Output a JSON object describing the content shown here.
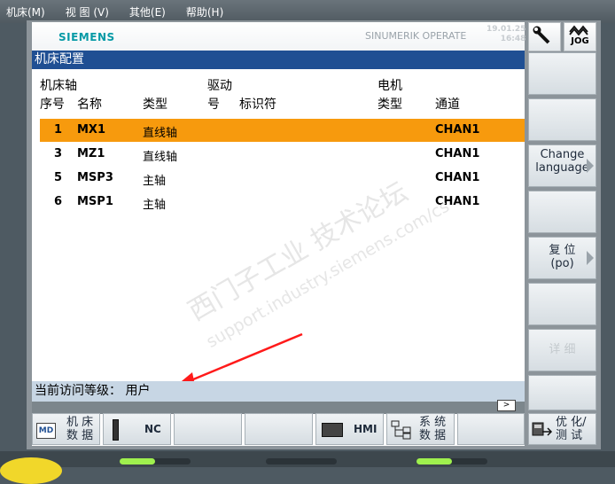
{
  "menubar": {
    "items": [
      "机床(M)",
      "视 图 (V)",
      "其他(E)",
      "帮助(H)"
    ]
  },
  "header": {
    "brand": "SIEMENS",
    "product": "SINUMERIK OPERATE",
    "date": "19.01.25",
    "time": "16:48",
    "mode": "JOG"
  },
  "panel": {
    "title": "机床配置"
  },
  "table": {
    "col_group1": "机床轴",
    "col_group2": "驱动",
    "col_group3": "电机",
    "col_seq": "序号",
    "col_name": "名称",
    "col_type": "类型",
    "col_drive_no": "号",
    "col_id": "标识符",
    "col_motor_type": "类型",
    "col_channel": "通道",
    "rows": [
      {
        "seq": "1",
        "name": "MX1",
        "type": "直线轴",
        "channel": "CHAN1",
        "selected": true
      },
      {
        "seq": "3",
        "name": "MZ1",
        "type": "直线轴",
        "channel": "CHAN1",
        "selected": false
      },
      {
        "seq": "5",
        "name": "MSP3",
        "type": "主轴",
        "channel": "CHAN1",
        "selected": false
      },
      {
        "seq": "6",
        "name": "MSP1",
        "type": "主轴",
        "channel": "CHAN1",
        "selected": false
      }
    ]
  },
  "status": {
    "access_level": "当前访问等级：  用户"
  },
  "watermark": {
    "line1": "西门子工业 技术论坛",
    "line2": "support.industry.siemens.com/cs"
  },
  "vsoftkeys": {
    "change_language_1": "Change",
    "change_language_2": "language",
    "reset_1": "复 位",
    "reset_2": "(po)",
    "details": "详 细"
  },
  "hsoftkeys": {
    "md_icon": "MD",
    "machine_data_1": "机 床",
    "machine_data_2": "数 据",
    "nc": "NC",
    "hmi": "HMI",
    "system_data_1": "系 统",
    "system_data_2": "数 据",
    "optimize_1": "优 化/",
    "optimize_2": "测 试"
  },
  "colors": {
    "title_bar": "#1f4f93",
    "selected_row": "#f79a0d",
    "status_bar": "#c7d6e4",
    "brand": "#069aa6"
  }
}
